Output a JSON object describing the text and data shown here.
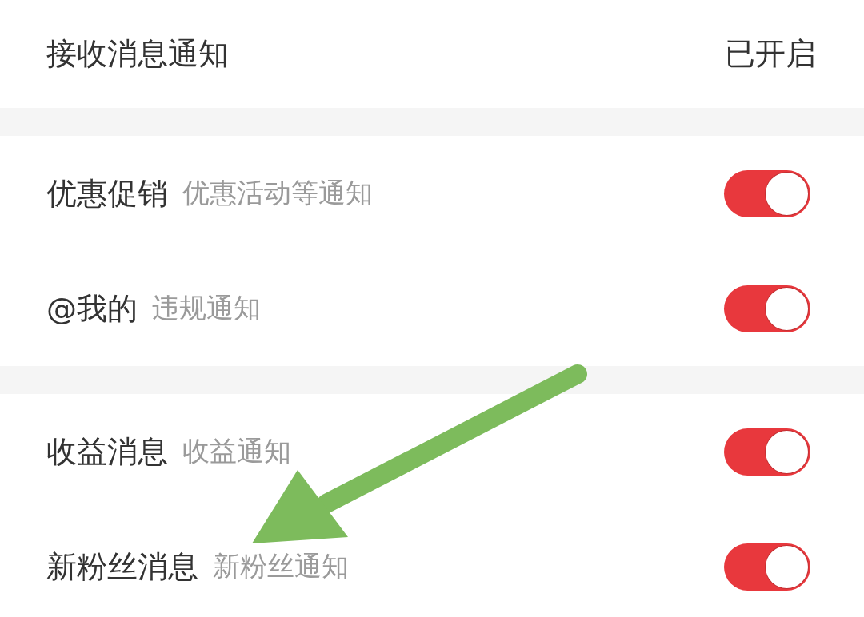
{
  "header": {
    "label": "接收消息通知",
    "status": "已开启"
  },
  "groups": [
    {
      "items": [
        {
          "title": "优惠促销",
          "description": "优惠活动等通知",
          "on": true
        },
        {
          "title": "@我的",
          "description": "违规通知",
          "on": true
        }
      ]
    },
    {
      "items": [
        {
          "title": "收益消息",
          "description": "收益通知",
          "on": true
        },
        {
          "title": "新粉丝消息",
          "description": "新粉丝通知",
          "on": true
        }
      ]
    }
  ]
}
